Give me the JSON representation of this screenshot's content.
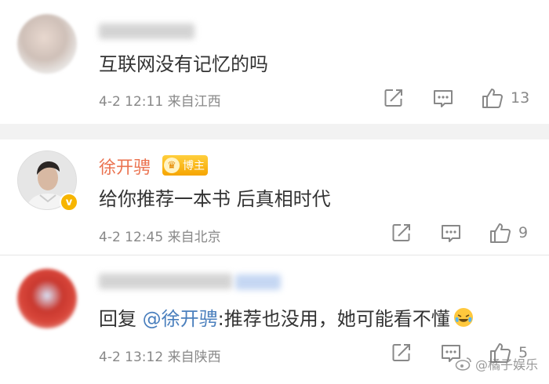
{
  "colors": {
    "username": "#eb7350",
    "mention": "#4a7fbd",
    "meta": "#888888",
    "badge": "#f6a500",
    "divider": "#f2f2f2"
  },
  "comments": [
    {
      "name": "",
      "text": "互联网没有记忆的吗",
      "time": "4-2 12:11",
      "location": "来自江西",
      "likes": "13"
    },
    {
      "name": "徐开骋",
      "badge": "博主",
      "text": "给你推荐一本书 后真相时代",
      "time": "4-2 12:45",
      "location": "来自北京",
      "likes": "9"
    },
    {
      "name": "",
      "reply_prefix": "回复 ",
      "mention": "@徐开骋",
      "text": ":推荐也没用，她可能看不懂",
      "time": "4-2 13:12",
      "location": "来自陕西",
      "likes": "5"
    }
  ],
  "watermark": {
    "text": "@橘子娱乐"
  },
  "icons": {
    "share": "share-icon",
    "comment": "comment-icon",
    "like": "thumbs-up-icon",
    "verified": "verified-badge-icon",
    "crown": "crown-icon",
    "emoji": "laugh-cry-emoji"
  }
}
